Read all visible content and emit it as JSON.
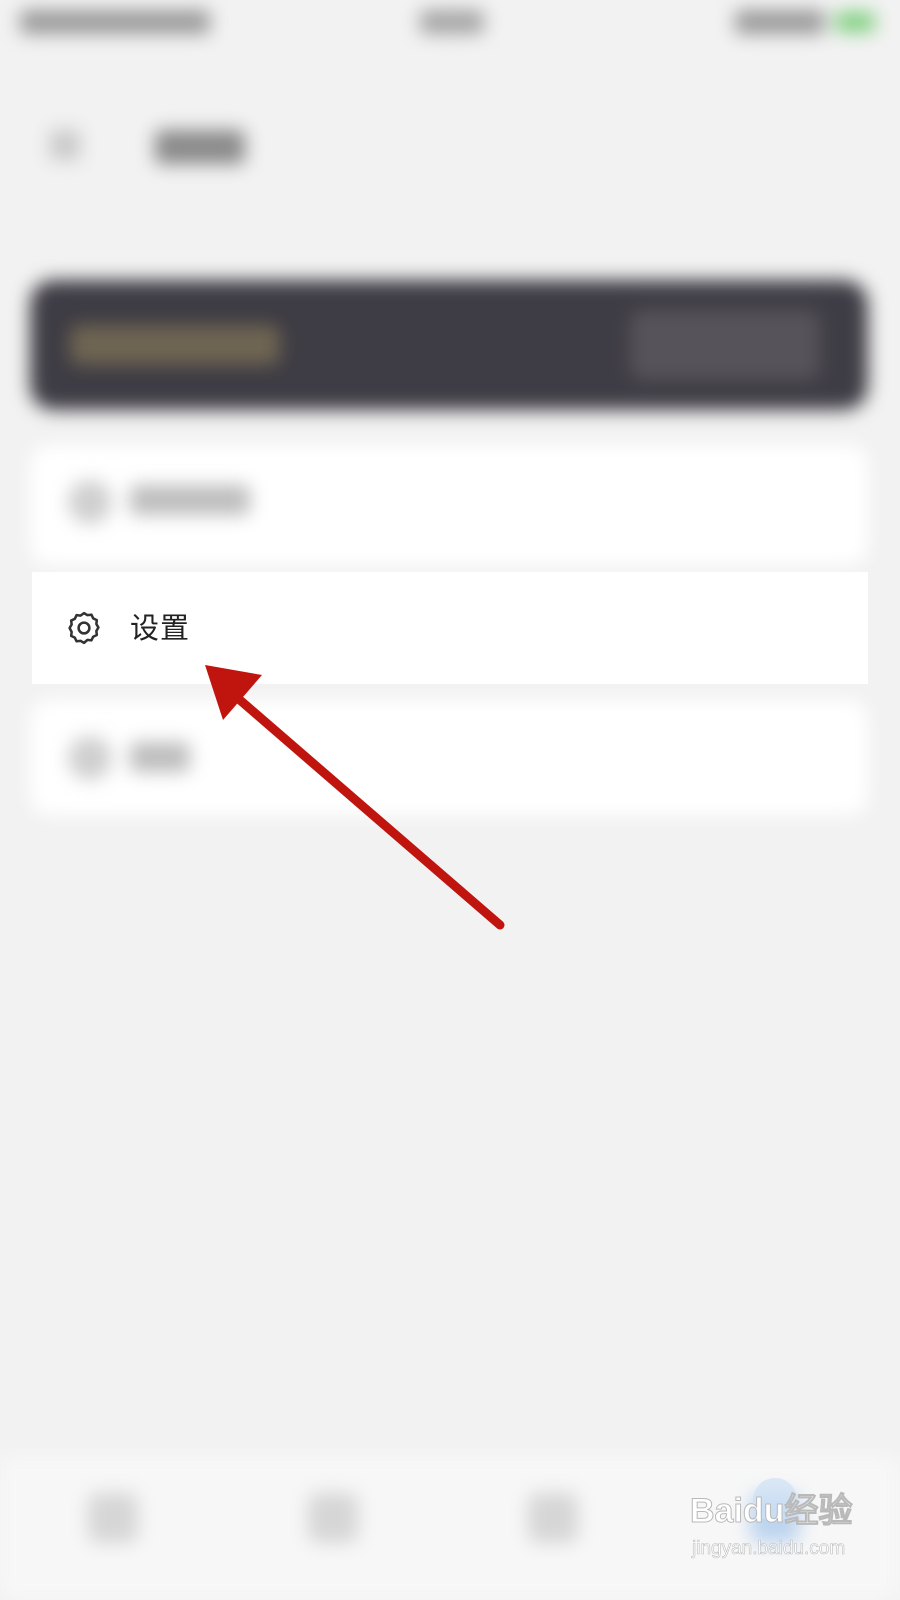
{
  "menu": {
    "settings_label": "设置"
  },
  "icons": {
    "settings": "gear-icon",
    "annotation": "red-arrow-pointer"
  },
  "colors": {
    "background": "#f2f2f2",
    "card": "#ffffff",
    "banner": "#3e3c44",
    "arrow": "#c0150f",
    "label": "#222222"
  },
  "watermark": {
    "brand": "Baidu经验",
    "url": "jingyan.baidu.com"
  }
}
